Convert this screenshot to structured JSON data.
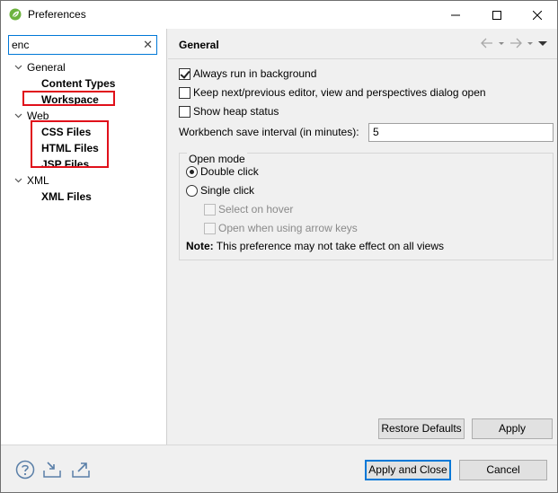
{
  "window": {
    "title": "Preferences"
  },
  "filter": {
    "value": "enc"
  },
  "tree": {
    "items": [
      {
        "label": "General",
        "level": 0,
        "expanded": true,
        "bold": false
      },
      {
        "label": "Content Types",
        "level": 1,
        "bold": true
      },
      {
        "label": "Workspace",
        "level": 1,
        "bold": true,
        "highlighted": true
      },
      {
        "label": "Web",
        "level": 0,
        "expanded": true,
        "bold": false
      },
      {
        "label": "CSS Files",
        "level": 1,
        "bold": true,
        "highlighted": true
      },
      {
        "label": "HTML Files",
        "level": 1,
        "bold": true,
        "highlighted": true
      },
      {
        "label": "JSP Files",
        "level": 1,
        "bold": true,
        "highlighted": true
      },
      {
        "label": "XML",
        "level": 0,
        "expanded": true,
        "bold": false
      },
      {
        "label": "XML Files",
        "level": 1,
        "bold": true
      }
    ]
  },
  "page": {
    "title": "General",
    "options": {
      "always_run_background": {
        "label": "Always run in background",
        "checked": true
      },
      "keep_next_prev": {
        "label": "Keep next/previous editor, view and perspectives dialog open",
        "checked": false
      },
      "show_heap": {
        "label": "Show heap status",
        "checked": false
      }
    },
    "save_interval": {
      "label": "Workbench save interval (in minutes):",
      "value": "5"
    },
    "open_mode": {
      "title": "Open mode",
      "double_click": {
        "label": "Double click",
        "selected": true
      },
      "single_click": {
        "label": "Single click",
        "selected": false
      },
      "select_on_hover": {
        "label": "Select on hover",
        "checked": false,
        "enabled": false
      },
      "open_arrow_keys": {
        "label": "Open when using arrow keys",
        "checked": false,
        "enabled": false
      }
    },
    "note": {
      "prefix": "Note:",
      "text": " This preference may not take effect on all views"
    },
    "buttons": {
      "restore_defaults": "Restore Defaults",
      "apply": "Apply"
    }
  },
  "footer": {
    "apply_close": "Apply and Close",
    "cancel": "Cancel"
  },
  "colors": {
    "highlight_box": "#e0101a",
    "accent": "#0078d7",
    "app_icon": "#6db33f"
  },
  "icons": [
    "spring-leaf-icon",
    "minimize-icon",
    "maximize-icon",
    "close-icon",
    "clear-icon",
    "chevron-down-icon",
    "back-arrow-icon",
    "forward-arrow-icon",
    "menu-triangle-icon",
    "help-icon",
    "import-icon",
    "export-icon"
  ]
}
